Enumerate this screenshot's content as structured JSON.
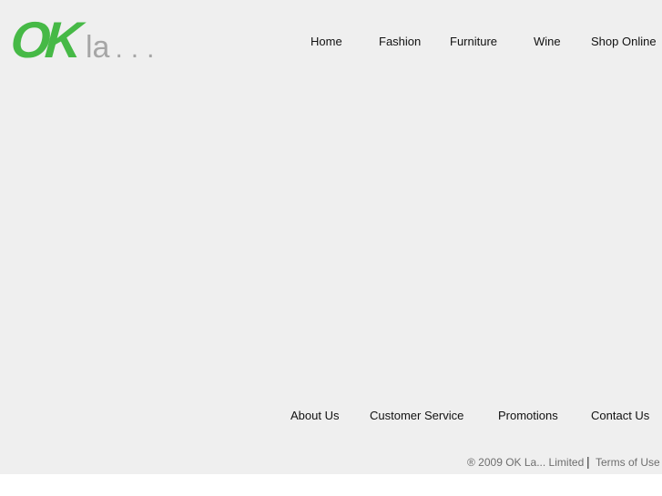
{
  "logo": {
    "ok": "OK",
    "la": "la",
    "dots": "..."
  },
  "top_nav": {
    "items": [
      {
        "label": "Home"
      },
      {
        "label": "Fashion"
      },
      {
        "label": "Furniture"
      },
      {
        "label": "Wine"
      },
      {
        "label": "Shop Online"
      }
    ]
  },
  "bottom_nav": {
    "items": [
      {
        "label": "About Us"
      },
      {
        "label": "Customer Service"
      },
      {
        "label": "Promotions"
      },
      {
        "label": "Contact Us"
      }
    ]
  },
  "footer": {
    "copyright": "® 2009 OK La... Limited",
    "separator": "|",
    "terms": "Terms of Use"
  },
  "colors": {
    "brand_green": "#46b946",
    "logo_gray": "#a6a6a6",
    "background": "#efefef"
  }
}
